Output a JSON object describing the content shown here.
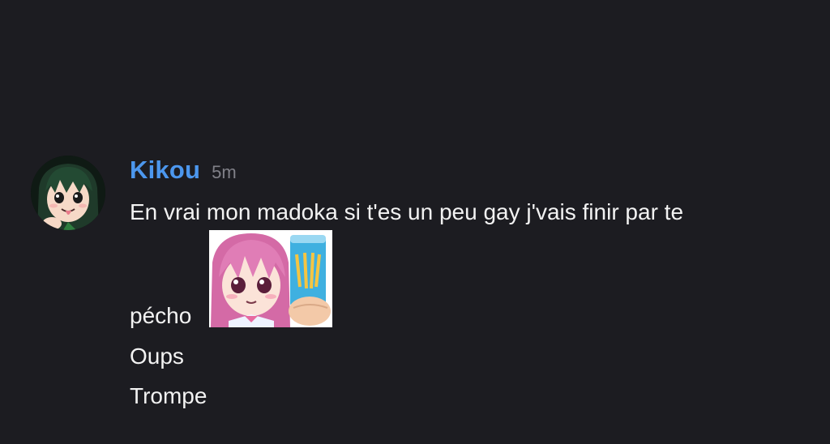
{
  "message": {
    "author": "Kikou",
    "time": "5m",
    "avatar_icon": "anime-frog-girl-avatar",
    "lines": [
      "En vrai mon madoka si t'es un peu gay j'vais finir par te",
      "pécho",
      "Oups",
      "Trompe"
    ],
    "custom_emoji": "anime-girl-energy-drink-emoji"
  },
  "colors": {
    "background": "#1c1c21",
    "username": "#4c97ee",
    "timestamp": "#808088",
    "text": "#f2f2f2"
  }
}
